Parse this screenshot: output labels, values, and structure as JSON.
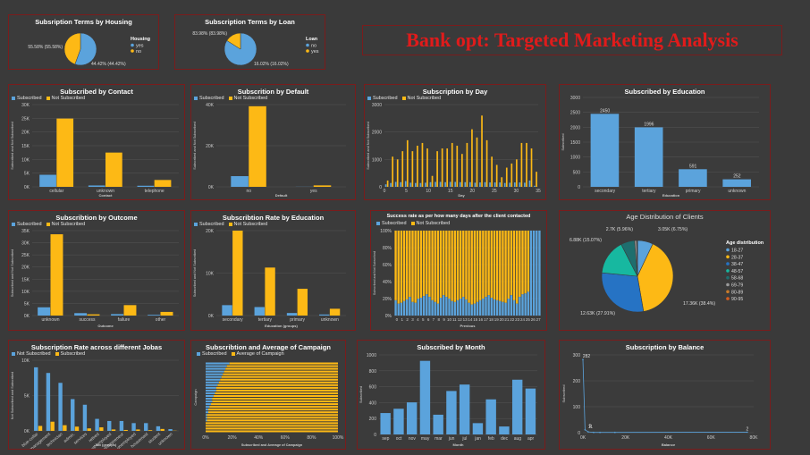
{
  "dashboard_title": "Bank opt: Targeted Marketing Analysis",
  "colors": {
    "subscribed": "#5ba3dc",
    "not_subscribed": "#fdb915",
    "grid": "#555555"
  },
  "legend": {
    "subscribed": "Subscribed",
    "not_subscribed": "Not Subscribed"
  },
  "pie_housing": {
    "title": "Subsription Terms by Housing",
    "legend_title": "Housing",
    "items": [
      {
        "name": "yes",
        "value": 55.58,
        "label": "55.58% (55.58%)",
        "color": "#5ba3dc"
      },
      {
        "name": "no",
        "value": 44.42,
        "label": "44.42% (44.42%)",
        "color": "#fdb915"
      }
    ]
  },
  "pie_loan": {
    "title": "Subscription Terms by Loan",
    "legend_title": "Loan",
    "items": [
      {
        "name": "no",
        "value": 83.98,
        "label": "83.98% (83.98%)",
        "color": "#5ba3dc"
      },
      {
        "name": "yes",
        "value": 16.02,
        "label": "16.02% (16.02%)",
        "color": "#fdb915"
      }
    ]
  },
  "chart_data": [
    {
      "id": "contact",
      "type": "bar",
      "title": "Subscribed by Contact",
      "categories": [
        "cellular",
        "unknown",
        "telephone"
      ],
      "series": [
        {
          "name": "Subscribed",
          "values": [
            4400,
            500,
            400
          ]
        },
        {
          "name": "Not Subscribed",
          "values": [
            24900,
            12500,
            2500
          ]
        }
      ],
      "xlabel": "Contact",
      "ylabel": "Subscribed and Not Subscribed",
      "ylim": [
        0,
        30000
      ],
      "yticks": [
        "0K",
        "5K",
        "10K",
        "15K",
        "20K",
        "25K",
        "30K"
      ]
    },
    {
      "id": "default",
      "type": "bar",
      "title": "Subscrition by Default",
      "categories": [
        "no",
        "yes"
      ],
      "series": [
        {
          "name": "Subscribed",
          "values": [
            5200,
            50
          ]
        },
        {
          "name": "Not Subscribed",
          "values": [
            39200,
            700
          ]
        }
      ],
      "xlabel": "Default",
      "ylabel": "Subscribed and Not Subscribed",
      "ylim": [
        0,
        40000
      ],
      "yticks": [
        "0K",
        "20K",
        "40K"
      ]
    },
    {
      "id": "day",
      "type": "bar",
      "title": "Subscription by Day",
      "categories": [
        1,
        2,
        3,
        4,
        5,
        6,
        7,
        8,
        9,
        10,
        11,
        12,
        13,
        14,
        15,
        16,
        17,
        18,
        19,
        20,
        21,
        22,
        23,
        24,
        25,
        26,
        27,
        28,
        29,
        30,
        31
      ],
      "series": [
        {
          "name": "Subscribed",
          "values": [
            90,
            140,
            180,
            170,
            210,
            150,
            140,
            140,
            150,
            170,
            180,
            180,
            170,
            180,
            180,
            170,
            170,
            170,
            150,
            160,
            170,
            160,
            160,
            160,
            140,
            150,
            160,
            160,
            150,
            230,
            40
          ]
        },
        {
          "name": "Not Subscribed",
          "values": [
            230,
            1100,
            1000,
            1300,
            1700,
            1300,
            1500,
            1600,
            1400,
            400,
            1300,
            1400,
            1400,
            1600,
            1500,
            1200,
            1600,
            2100,
            1800,
            2600,
            1700,
            1100,
            800,
            350,
            700,
            850,
            1000,
            1600,
            1600,
            1400,
            550
          ]
        }
      ],
      "xlabel": "Day",
      "ylabel": "Subscribed and Not Subscribed",
      "ylim": [
        0,
        3000
      ],
      "yticks": [
        "0",
        "1000",
        "2000",
        "3000"
      ],
      "xticks": [
        "0",
        "5",
        "10",
        "15",
        "20",
        "25",
        "30",
        "35"
      ]
    },
    {
      "id": "education",
      "type": "bar",
      "title": "Subscribed by Education",
      "categories": [
        "secondary",
        "tertiary",
        "primary",
        "unknown"
      ],
      "values": [
        2450,
        1996,
        591,
        252
      ],
      "xlabel": "Education",
      "ylabel": "Subscribed",
      "ylim": [
        0,
        3000
      ],
      "yticks": [
        "0",
        "500",
        "1000",
        "1500",
        "2000",
        "2500",
        "3000"
      ]
    },
    {
      "id": "outcome",
      "type": "bar",
      "title": "Subscribtion by Outcome",
      "categories": [
        "unknown",
        "success",
        "failure",
        "other"
      ],
      "series": [
        {
          "name": "Subscribed",
          "values": [
            3400,
            1000,
            600,
            300
          ]
        },
        {
          "name": "Not Subscribed",
          "values": [
            33500,
            500,
            4300,
            1500
          ]
        }
      ],
      "xlabel": "Outcome",
      "ylabel": "Subscribed and Not Subscribed",
      "ylim": [
        0,
        35000
      ],
      "yticks": [
        "0K",
        "5K",
        "10K",
        "15K",
        "20K",
        "25K",
        "30K",
        "35K"
      ]
    },
    {
      "id": "rate_education",
      "type": "bar",
      "title": "Subscribtion Rate by Education",
      "categories": [
        "secondary",
        "tertiary",
        "primary",
        "unknown"
      ],
      "series": [
        {
          "name": "Subscribed",
          "values": [
            2450,
            2000,
            600,
            250
          ]
        },
        {
          "name": "Not Subscribed",
          "values": [
            20800,
            11300,
            6300,
            1600
          ]
        }
      ],
      "xlabel": "Education (groups)",
      "ylabel": "Subscribed and Not Subscribed",
      "ylim": [
        0,
        20000
      ],
      "yticks": [
        "0K",
        "10K",
        "20K"
      ]
    },
    {
      "id": "success_rate",
      "type": "bar",
      "title": "Success rate as per how many days after the client contacted",
      "categories": [
        1,
        2,
        3,
        4,
        5,
        6,
        7,
        8,
        9,
        10,
        11,
        12,
        13,
        14,
        15,
        16,
        17,
        18,
        19,
        20,
        21,
        22,
        23,
        24,
        25,
        26,
        27,
        28,
        29,
        30,
        31,
        32,
        33,
        34,
        35,
        36,
        37,
        38,
        39,
        40,
        41,
        42,
        43,
        44,
        45,
        46,
        47,
        48,
        49,
        50,
        51,
        52
      ],
      "series": [
        {
          "name": "Subscribed",
          "values": [
            18,
            14,
            15,
            17,
            19,
            22,
            16,
            15,
            20,
            21,
            23,
            25,
            22,
            18,
            16,
            14,
            21,
            24,
            22,
            20,
            17,
            16,
            18,
            20,
            22,
            19,
            15,
            13,
            14,
            16,
            18,
            20,
            22,
            24,
            21,
            19,
            18,
            17,
            16,
            15,
            20,
            24,
            18,
            14,
            22,
            25,
            26,
            28,
            100,
            100,
            100,
            100
          ]
        }
      ],
      "xlabel": "Previous",
      "ylabel": "Subscribed and Not Subscribed",
      "ylim": [
        0,
        100
      ],
      "yticks": [
        "0%",
        "20%",
        "40%",
        "60%",
        "80%",
        "100%"
      ],
      "xticks": [
        "0",
        "1",
        "2",
        "3",
        "4",
        "5",
        "6",
        "7",
        "8",
        "9",
        "10",
        "11",
        "12",
        "13",
        "14",
        "15",
        "16",
        "17",
        "18",
        "19",
        "20",
        "21",
        "22",
        "23",
        "24",
        "25",
        "26",
        "27"
      ]
    },
    {
      "id": "age",
      "type": "pie",
      "title": "Age Distribution of Clients",
      "legend_title": "Age distribution",
      "categories": [
        "18-27",
        "28-37",
        "38-47",
        "48-57",
        "58-68",
        "69-79",
        "80-89",
        "90-95"
      ],
      "values": [
        3050,
        17360,
        12630,
        6880,
        2700,
        400,
        130,
        20
      ],
      "labels": [
        "3.05K (6.75%)",
        "17.36K (38.4%)",
        "12.63K (27.91%)",
        "6.88K (15.07%)",
        "2.7K (5.96%)"
      ],
      "colors": [
        "#5ba3dc",
        "#fdb915",
        "#2673c4",
        "#17b8a0",
        "#1e6e6e",
        "#9a9a9a",
        "#c97b2a",
        "#d45c1e"
      ]
    },
    {
      "id": "jobs",
      "type": "bar",
      "title": "Subscription Rate across different Jobas",
      "categories": [
        "blue-collar",
        "management",
        "technician",
        "admin.",
        "services",
        "retired",
        "self-employed",
        "entrepreneur",
        "unemployed",
        "housemaid",
        "student",
        "unknown"
      ],
      "series": [
        {
          "name": "Not Subscribed",
          "values": [
            9000,
            8200,
            6800,
            4500,
            3700,
            1700,
            1400,
            1400,
            1100,
            1100,
            650,
            250
          ]
        },
        {
          "name": "Subscribed",
          "values": [
            700,
            1300,
            800,
            600,
            350,
            500,
            200,
            130,
            200,
            100,
            270,
            30
          ]
        }
      ],
      "xlabel": "Job (groups)",
      "ylabel": "Not Subscribed and Subscribed",
      "ylim": [
        0,
        10000
      ],
      "yticks": [
        "0K",
        "5K",
        "10K"
      ]
    },
    {
      "id": "campaign",
      "type": "bar",
      "title": "Subscribtion and Average of Campaign",
      "categories": [
        1,
        2,
        3,
        4,
        5,
        6,
        7,
        8,
        9,
        10,
        11,
        12,
        13,
        14,
        15,
        16,
        17,
        18,
        19,
        20,
        21,
        22,
        23,
        24,
        25,
        26
      ],
      "series": [
        {
          "name": "Subscribed",
          "values": [
            18,
            16,
            15,
            14,
            13,
            12,
            11,
            10,
            9,
            8,
            8,
            7,
            6,
            5,
            5,
            4,
            3,
            2,
            2,
            1,
            1,
            1,
            0,
            0,
            0,
            0
          ]
        },
        {
          "name": "Average of Campaign",
          "values": [
            82,
            84,
            85,
            86,
            87,
            88,
            89,
            90,
            91,
            92,
            92,
            93,
            94,
            95,
            95,
            96,
            97,
            98,
            98,
            99,
            99,
            99,
            100,
            100,
            100,
            100
          ]
        }
      ],
      "xlabel": "Subscribed and Average of Campaign",
      "ylabel": "Campaign",
      "xlim": [
        0,
        100
      ],
      "xticks": [
        "0%",
        "20%",
        "40%",
        "60%",
        "80%",
        "100%"
      ]
    },
    {
      "id": "month",
      "type": "bar",
      "title": "Subscribed by Month",
      "categories": [
        "sep",
        "oct",
        "nov",
        "may",
        "mar",
        "jun",
        "jul",
        "jan",
        "feb",
        "dec",
        "aug",
        "apr"
      ],
      "values": [
        269,
        323,
        403,
        925,
        248,
        546,
        627,
        142,
        441,
        100,
        688,
        577
      ],
      "xlabel": "Month",
      "ylabel": "Subscribed",
      "ylim": [
        0,
        1000
      ],
      "yticks": [
        "0",
        "200",
        "400",
        "600",
        "800",
        "1000"
      ]
    },
    {
      "id": "balance",
      "type": "scatter",
      "title": "Subscription by Balance",
      "points": [
        [
          0,
          282
        ],
        [
          1000,
          11
        ],
        [
          2500,
          3
        ],
        [
          5000,
          1
        ],
        [
          8000,
          1
        ],
        [
          15000,
          1
        ],
        [
          77000,
          2
        ]
      ],
      "point_labels": [
        "282",
        "11",
        "1",
        "2"
      ],
      "xlabel": "Balance",
      "ylabel": "Subscribed",
      "xlim": [
        0,
        80000
      ],
      "ylim": [
        0,
        300
      ],
      "yticks": [
        "0",
        "100",
        "200",
        "300"
      ],
      "xticks": [
        "0K",
        "20K",
        "40K",
        "60K",
        "80K"
      ]
    }
  ]
}
